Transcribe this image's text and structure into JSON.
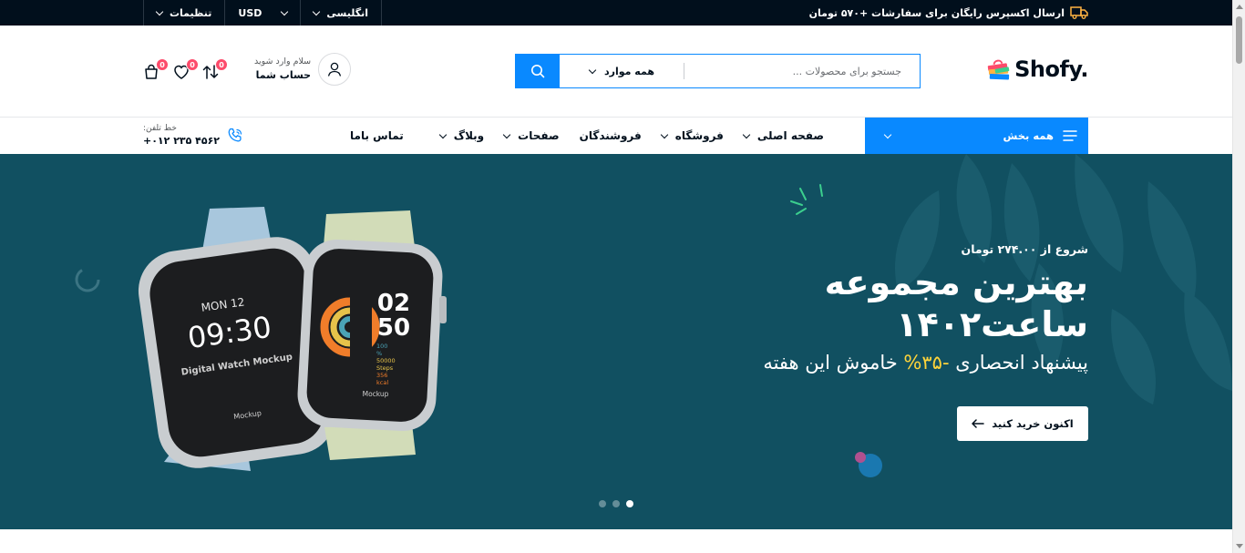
{
  "topbar": {
    "shipping_text": "ارسال اکسپرس رایگان برای سفارشات +۵۷۰ تومان",
    "language": "انگلیسی",
    "currency": "USD",
    "settings": "تنظیمات"
  },
  "header": {
    "logo_text": "Shofy.",
    "search_placeholder": "جستجو برای محصولات ...",
    "search_category": "همه موارد",
    "account_greeting": "سلام وارد شوید",
    "account_label": "حساب شما",
    "compare_count": "0",
    "wishlist_count": "0",
    "cart_count": "0"
  },
  "nav": {
    "categories_label": "همه بخش",
    "items": [
      {
        "label": "صفحه اصلی",
        "has_dropdown": true
      },
      {
        "label": "فروشگاه",
        "has_dropdown": true
      },
      {
        "label": "فروشندگان",
        "has_dropdown": false
      },
      {
        "label": "صفحات",
        "has_dropdown": true
      },
      {
        "label": "وبلاگ",
        "has_dropdown": true
      },
      {
        "label": "تماس باما",
        "has_dropdown": false
      }
    ],
    "phone_label": "خط تلفن:",
    "phone_number": "+۰۱۲ ۲۳۵ ۴۵۶۲"
  },
  "hero": {
    "subtitle": "شروع از ۲۷۴.۰۰ تومان",
    "title_line1": "بهترین مجموعه",
    "title_line2": "ساعت۱۴۰۲",
    "offer_prefix": "پیشنهاد انحصاری",
    "offer_percent": "-۳۵%",
    "offer_suffix": "خاموش این هفته",
    "cta_label": "اکنون خرید کنید",
    "watch1_date": "MON 12",
    "watch1_time": "09:30",
    "watch1_caption": "Digital Watch Mockup",
    "watch1_brand": "Mockup",
    "watch2_hour": "02",
    "watch2_min": "50",
    "watch2_stats": [
      "100",
      "%",
      "50000",
      "Steps",
      "356",
      "kcal"
    ],
    "watch2_brand": "Mockup",
    "slide_count": 3,
    "active_slide": 3
  },
  "colors": {
    "topbar_bg": "#010f1c",
    "accent": "#0989ff",
    "hero_bg": "#115061",
    "badge": "#fd4b6b",
    "highlight": "#ffd43a"
  }
}
